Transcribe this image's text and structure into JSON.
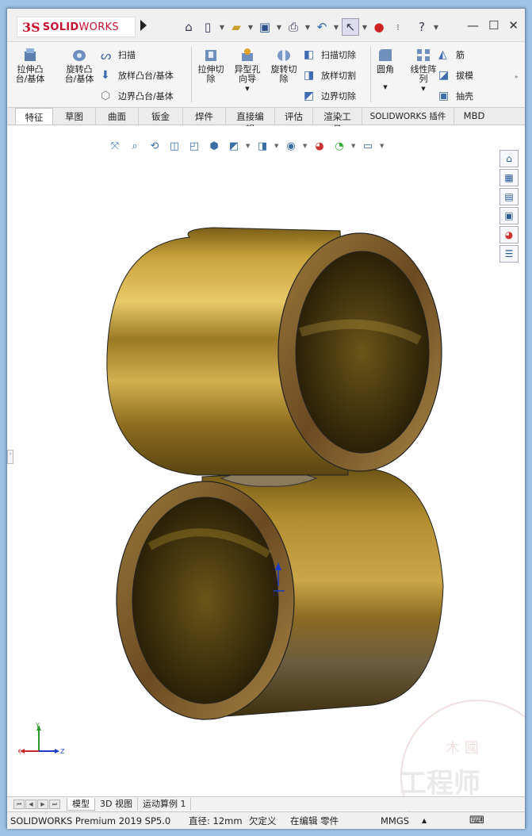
{
  "app": {
    "logo_ds": "3S",
    "logo_solid": "SOLID",
    "logo_works": "WORKS"
  },
  "ribbon": {
    "extrude_boss": "拉伸凸\n台/基体",
    "revolve_boss": "旋转凸\n台/基体",
    "sweep": "扫描",
    "loft_boss": "放样凸台/基体",
    "boundary_boss": "边界凸台/基体",
    "extrude_cut": "拉伸切\n除",
    "hole_wizard": "异型孔\n向导",
    "revolve_cut": "旋转切\n除",
    "swept_cut": "扫描切除",
    "lofted_cut": "放样切割",
    "boundary_cut": "边界切除",
    "fillet": "圆角",
    "linear_pattern": "线性阵\n列",
    "rib": "筋",
    "draft": "拔模",
    "shell": "抽壳"
  },
  "tabs": [
    "特征",
    "草图",
    "曲面",
    "钣金",
    "焊件",
    "直接编辑",
    "评估",
    "渲染工具",
    "SOLIDWORKS 插件",
    "MBD"
  ],
  "active_tab": "特征",
  "bottom_tabs": [
    "模型",
    "3D 视图",
    "运动算例 1"
  ],
  "active_bottom_tab": "模型",
  "status": {
    "product": "SOLIDWORKS Premium 2019 SP5.0",
    "measure": "直径: 12mm",
    "definition": "欠定义",
    "mode": "在编辑 零件",
    "units": "MMGS",
    "units_arrow": "▲"
  },
  "triad": {
    "x": "X",
    "y": "Y",
    "z": "Z"
  },
  "watermark": {
    "line1": "木 國",
    "line2": "工程师"
  },
  "colors": {
    "brass": "#b08a2a",
    "accent": "#c8102e",
    "window_bg": "#9ec3e6"
  }
}
